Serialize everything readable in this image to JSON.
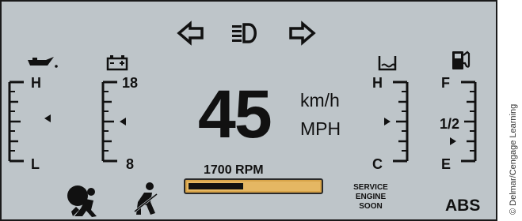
{
  "speedometer": {
    "value": "45",
    "unit_top": "km/h",
    "unit_bottom": "MPH"
  },
  "tachometer": {
    "label": "1700 RPM",
    "level": 0.42
  },
  "oil_gauge": {
    "top": "H",
    "bottom": "L"
  },
  "battery_gauge": {
    "top": "18",
    "bottom": "8"
  },
  "temp_gauge": {
    "top": "H",
    "bottom": "C"
  },
  "fuel_gauge": {
    "top": "F",
    "middle": "1/2",
    "bottom": "E"
  },
  "warnings": {
    "service_line1": "SERVICE",
    "service_line2": "ENGINE",
    "service_line3": "SOON",
    "abs": "ABS"
  },
  "credit": "© Delmar/Cengage Learning",
  "icons": [
    "left-turn-arrow-icon",
    "headlight-icon",
    "right-turn-arrow-icon",
    "oil-can-icon",
    "battery-icon",
    "coolant-icon",
    "fuel-pump-icon",
    "airbag-icon",
    "seatbelt-icon"
  ],
  "colors": {
    "panel": "#bec5c9",
    "rpm_bar": "#e5b763",
    "ink": "#111111"
  }
}
